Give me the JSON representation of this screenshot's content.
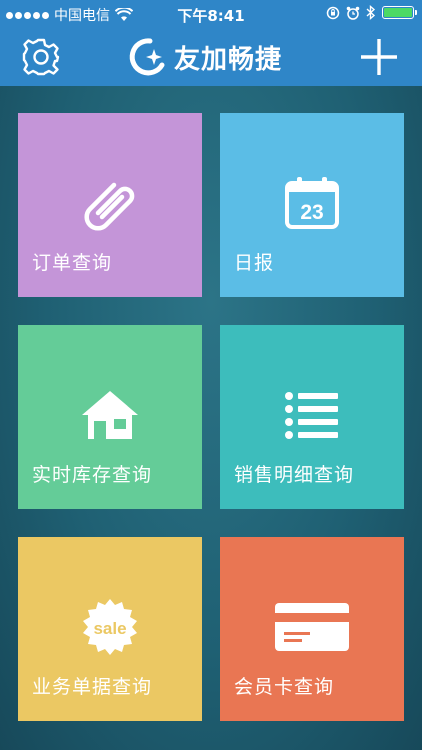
{
  "status_bar": {
    "carrier": "中国电信",
    "time": "下午8:41",
    "battery_level": 1.0
  },
  "nav": {
    "title": "友加畅捷",
    "settings_icon": "gear-icon",
    "add_icon": "plus-icon",
    "bar_color": "#2f86c8"
  },
  "tiles": [
    {
      "label": "订单查询",
      "icon": "paperclip-icon",
      "color": "#c495d8"
    },
    {
      "label": "日报",
      "icon": "calendar-icon",
      "icon_text": "23",
      "color": "#5bbde6"
    },
    {
      "label": "实时库存查询",
      "icon": "house-icon",
      "color": "#64cc98"
    },
    {
      "label": "销售明细查询",
      "icon": "list-icon",
      "color": "#3dbdbc"
    },
    {
      "label": "业务单据查询",
      "icon": "sale-badge-icon",
      "icon_text": "sale",
      "color": "#ebc863"
    },
    {
      "label": "会员卡查询",
      "icon": "card-icon",
      "color": "#e97653"
    }
  ]
}
